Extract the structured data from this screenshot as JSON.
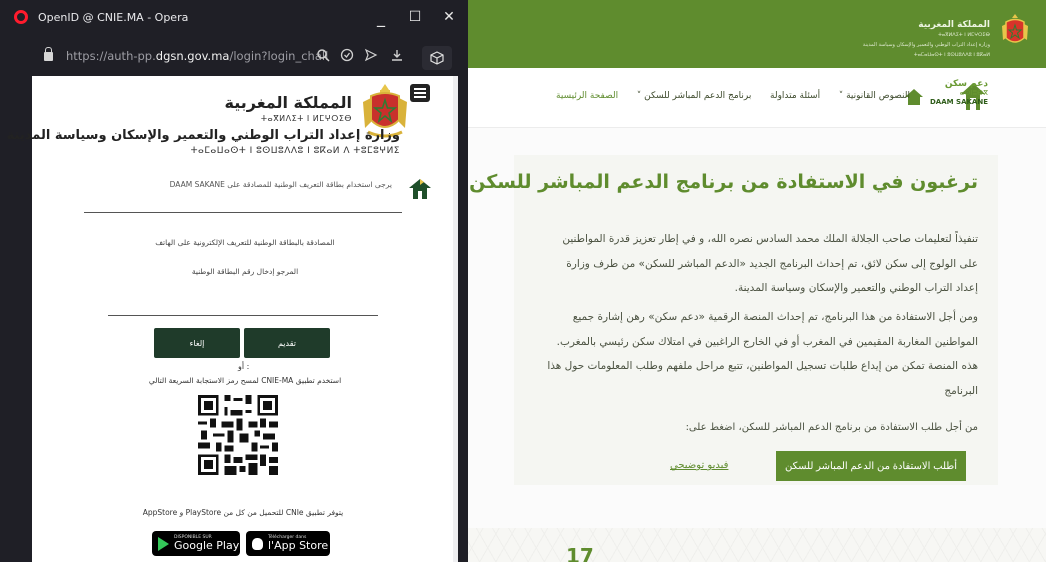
{
  "browser": {
    "title": "OpenID @ CNIE.MA - Opera",
    "url_prefix": "https://auth-pp.",
    "url_domain": "dgsn.gov.ma",
    "url_path": "/login?login_chall",
    "controls": {
      "minimize": "_",
      "maximize": "☐",
      "close": "✕"
    }
  },
  "login": {
    "kingdom_ar": "المملكة المغربية",
    "kingdom_tifinagh": "ⵜⴰⴳⵍⴷⵉⵜ ⵏ ⵍⵎⵖⵔⵉⴱ",
    "ministry_ar": "وزارة إعداد التراب الوطني والتعمير والإسكان وسياسة المدينة",
    "ministry_tifinagh": "ⵜⴰⵎⴰⵡⴰⵙⵜ ⵏ ⵓⵙⵡⵓⴷⴷⵓ ⵏ ⵓⴽⴰⵍ ⴷ ⵜⵓⵎⵓⵖⵍⵉ",
    "intro": "يرجى استخدام بطاقة التعريف الوطنية للمصادقة على DAAM SAKANE",
    "auth_label": "المصادقة بالبطاقة الوطنية للتعريف الإلكترونية على الهاتف",
    "cin_label": "المرجو إدخال رقم البطاقة الوطنية",
    "cin_value": "",
    "submit_label": "تقديم",
    "cancel_label": "إلغاء",
    "or_text": "أو :",
    "qr_note": "استخدم تطبيق CNIE-MA لمسح رمز الاستجابة السريعة التالي",
    "store_note": "يتوفر تطبيق CNIe للتحميل من كل من PlayStore و AppStore",
    "google_small": "DISPONIBLE SUR",
    "google_label": "Google Play",
    "apple_small": "Télécharger dans",
    "apple_label": "l'App Store"
  },
  "site": {
    "top_title": "المملكة المغربية",
    "top_tifinagh": "ⵜⴰⴳⵍⴷⵉⵜ ⵏ ⵍⵎⵖⵔⵉⴱ",
    "top_ministry": "وزارة إعداد التراب الوطني والتعمير والإسكان وسياسة المدينة",
    "top_ministry_tif": "ⵜⴰⵎⴰⵡⴰⵙⵜ ⵏ ⵓⵙⵡⵓⴷⴷⵓ ⵏ ⵓⴽⴰⵍ",
    "brand_ar": "دعم سكن",
    "brand_tif": "ⴰⵙⵏⵓⴱⴳ",
    "brand_en": "DAAM SAKANE",
    "nav": [
      "الصفحة الرئيسية",
      "برنامج الدعم المباشر للسكن ˅",
      "أسئلة متداولة",
      "النصوص القانونية ˅"
    ],
    "heading": "ترغبون في الاستفادة من برنامج الدعم المباشر للسكن",
    "para1": "تنفيذاً لتعليمات صاحب الجلالة الملك محمد السادس نصره الله، و في إطار تعزيز قدرة المواطنين على الولوج إلى سكن لائق، تم إحداث البرنامج الجديد «الدعم المباشر للسكن» من طرف وزارة إعداد التراب الوطني والتعمير والإسكان وسياسة المدينة.",
    "para2": "ومن أجل الاستفادة من هذا البرنامج، تم إحداث المنصة الرقمية «دعم سكن» رهن إشارة جميع المواطنين المغاربة المقيمين في المغرب أو في الخارج الراغبين في امتلاك سكن رئيسي بالمغرب. هذه المنصة تمكن من إيداع طلبات تسجيل المواطنين، تتبع مراحل ملفهم وطلب المعلومات حول هذا البرنامج",
    "para3": "من أجل طلب الاستفادة من برنامج الدعم المباشر للسكن، اضغط على:",
    "apply_label": "أطلب الاستفادة من الدعم المباشر للسكن",
    "video_label": "فيديو توضيحي"
  },
  "page_number": "17",
  "colors": {
    "brand_green": "#5f8c2e",
    "dark_green": "#1f3b2a",
    "chrome": "#1f1f26"
  }
}
